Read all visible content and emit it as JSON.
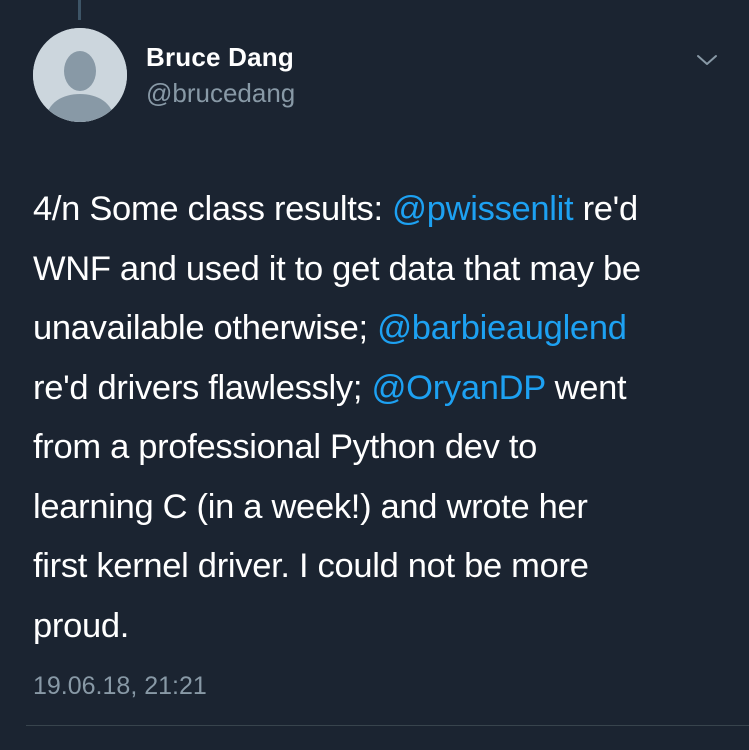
{
  "author": {
    "name": "Bruce Dang",
    "handle": "@brucedang",
    "avatar_icon": "default-avatar-icon"
  },
  "menu_icon": "chevron-down-icon",
  "tweet": {
    "lines": [
      {
        "before": "4/n Some class results: ",
        "mention": "@pwissenlit",
        "after": " re'd"
      },
      {
        "text": "WNF and used it to get data that may be"
      },
      {
        "before": "unavailable otherwise; ",
        "mention": "@barbieauglend",
        "after": ""
      },
      {
        "before": "re'd drivers flawlessly; ",
        "mention": "@OryanDP",
        "after": " went"
      },
      {
        "text": "from a professional Python dev to"
      },
      {
        "text": "learning C (in a week!) and wrote her"
      },
      {
        "text": "first kernel driver. I could not be more"
      },
      {
        "text": "proud."
      }
    ]
  },
  "timestamp": "19.06.18, 21:21",
  "colors": {
    "background": "#1b2431",
    "mention": "#1da1f2",
    "secondary_text": "#8899a6"
  }
}
